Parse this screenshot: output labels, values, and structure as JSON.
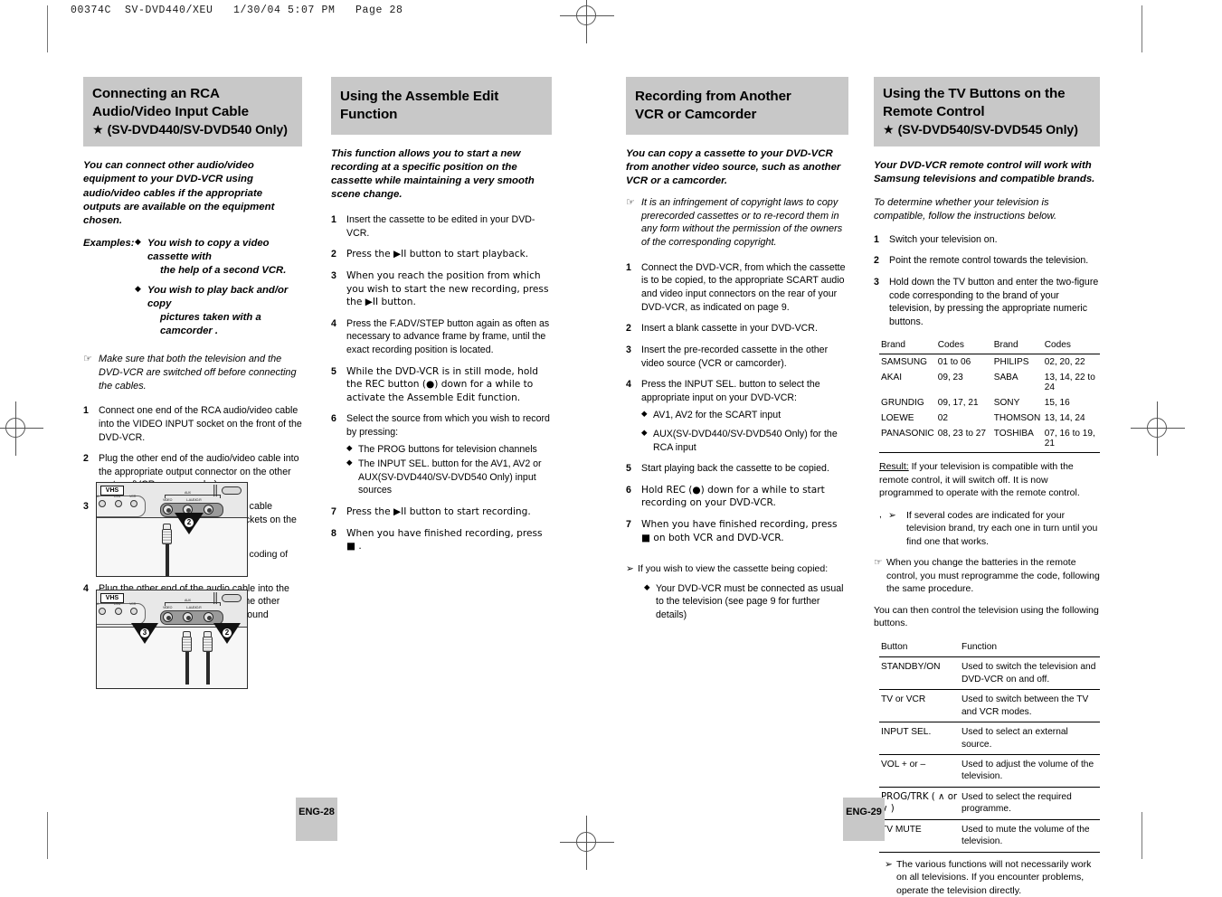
{
  "print_slug": "00374C  SV-DVD440/XEU   1/30/04 5:07 PM   Page 28",
  "colors": {
    "header_bg": "#c8c8c8",
    "page_badge_bg": "#c8c8c8",
    "text": "#000000"
  },
  "sections": {
    "rca": {
      "title_line1": "Connecting an RCA",
      "title_line2": "Audio/Video Input Cable",
      "title_star": "★",
      "title_sub": "(SV-DVD440/SV-DVD540 Only)",
      "lead": "You can connect other audio/video equipment to your DVD-VCR using audio/video cables if the appropriate outputs are available on the equipment chosen.",
      "examples_label": "Examples:",
      "examples": [
        {
          "line1": "You wish to copy a video cassette with",
          "line2": "the help of a second VCR."
        },
        {
          "line1": "You wish to play back and/or copy",
          "line2": "pictures taken with a camcorder ."
        }
      ],
      "hand_note": "Make sure that both the television and the DVD-VCR are switched off before connecting the cables.",
      "steps": [
        {
          "num": "1",
          "text": "Connect one end of the RCA audio/video cable into the VIDEO INPUT socket on the front of the DVD-VCR."
        },
        {
          "num": "2",
          "text": "Plug the other end of the audio/video cable into the appropriate output connector on the other system (VCR or camcorder)."
        },
        {
          "num": "3",
          "text": "Connect one end of the RCA audio cable supplied into the AUDIO INPUT sockets on the front of the DVD-VCR."
        },
        {
          "num": "4",
          "text": "Plug the other end of the audio cable into the appropriate output connectors on the other system (VCR, camcorder or Hi-Fi sound system)."
        }
      ],
      "step3_note": "Take care to respect the colour coding of the left and right channels.",
      "figures": {
        "fig1": {
          "vhs_label": "VHS",
          "callout": "2",
          "jack_labels": [
            "VIDEO",
            "L-AUDIO-R"
          ],
          "aux_label": "AUX"
        },
        "fig2": {
          "vhs_label": "VHS",
          "callouts": [
            "3",
            "2"
          ],
          "jack_labels": [
            "VIDEO",
            "L-AUDIO-R"
          ],
          "aux_label": "AUX"
        }
      }
    },
    "assemble": {
      "title_line1": "Using the Assemble Edit",
      "title_line2": "Function",
      "lead": "This function allows you to start a new recording at a specific position on the cassette while maintaining a very smooth scene change.",
      "steps": [
        {
          "num": "1",
          "text": "Insert the cassette to be edited in your DVD-VCR."
        },
        {
          "num": "2",
          "text": "Press the ▶II button to start playback."
        },
        {
          "num": "3",
          "text": "When you reach the position from which you wish to start the new recording, press the ▶II button."
        },
        {
          "num": "4",
          "text": "Press the F.ADV/STEP button again as often as necessary to advance frame by frame, until the exact recording position is located."
        },
        {
          "num": "5",
          "text": "While the DVD-VCR is in still mode, hold the REC button (●) down for a while to activate the Assemble Edit function."
        },
        {
          "num": "6",
          "text": "Select the source from which you wish to record by pressing:"
        },
        {
          "num": "7",
          "text": "Press the ▶II button to start recording."
        },
        {
          "num": "8",
          "text": "When you have finished recording, press ■ ."
        }
      ],
      "step6_bullets": [
        "The PROG buttons for television channels",
        "The INPUT SEL. button for the AV1, AV2 or AUX(SV-DVD440/SV-DVD540 Only) input sources"
      ]
    },
    "recording": {
      "title_line1": "Recording from Another",
      "title_line2": "VCR or Camcorder",
      "lead": "You can copy a cassette to your DVD-VCR from another video source, such as another VCR or a camcorder.",
      "hand_note": "It is an infringement of copyright laws to copy prerecorded cassettes or to re-record them in any form without the permission of the owners of the corresponding copyright.",
      "steps": [
        {
          "num": "1",
          "text": "Connect the DVD-VCR, from which the cassette is to be copied, to the appropriate SCART audio and video input connectors on the rear of your DVD-VCR, as indicated on page 9."
        },
        {
          "num": "2",
          "text": "Insert a blank cassette in your DVD-VCR."
        },
        {
          "num": "3",
          "text": "Insert the pre-recorded cassette in the other video source (VCR or camcorder)."
        },
        {
          "num": "4",
          "text": "Press the INPUT SEL. button to select the appropriate input on your DVD-VCR:"
        },
        {
          "num": "5",
          "text": "Start playing back the cassette to be copied."
        },
        {
          "num": "6",
          "text": "Hold REC (●) down for a while to start recording on your DVD-VCR."
        },
        {
          "num": "7",
          "text": "When you have finished recording, press ■  on both VCR and DVD-VCR."
        }
      ],
      "step4_bullets": [
        "AV1, AV2 for the SCART input",
        "AUX(SV-DVD440/SV-DVD540 Only) for the RCA input"
      ],
      "tail_note": "If you wish to view the cassette being copied:",
      "tail_bullet": "Your DVD-VCR must be connected as usual to the television (see page 9 for further details)"
    },
    "tvbuttons": {
      "title_line1": "Using the TV Buttons on the",
      "title_line2": "Remote Control",
      "title_star": "★",
      "title_sub": "(SV-DVD540/SV-DVD545 Only)",
      "lead": "Your DVD-VCR remote control will work with Samsung televisions and compatible brands.",
      "lead2": "To determine whether your television is compatible, follow the instructions below.",
      "steps": [
        {
          "num": "1",
          "text": "Switch your television on."
        },
        {
          "num": "2",
          "text": "Point the remote control towards the television."
        },
        {
          "num": "3",
          "text": "Hold down the TV button and enter the two-figure code corresponding to the brand of your television, by pressing the appropriate numeric buttons."
        }
      ],
      "codes_table": {
        "headers": [
          "Brand",
          "Codes",
          "Brand",
          "Codes"
        ],
        "rows": [
          [
            "SAMSUNG",
            "01 to 06",
            "PHILIPS",
            "02, 20, 22"
          ],
          [
            "AKAI",
            "09, 23",
            "SABA",
            "13, 14, 22 to 24"
          ],
          [
            "GRUNDIG",
            "09, 17, 21",
            "SONY",
            "15, 16"
          ],
          [
            "LOEWE",
            "02",
            "THOMSON",
            "13, 14, 24"
          ],
          [
            "PANASONIC",
            "08, 23 to 27",
            "TOSHIBA",
            "07, 16 to 19, 21"
          ]
        ]
      },
      "result_label": "Result:",
      "result_text": "If your television is compatible with the remote control, it will switch off. It is now programmed to operate with the remote control.",
      "arrow_note": "If several codes are indicated for your television brand, try each one in turn until you find one that works.",
      "hand_note": "When you change the batteries in the remote control, you must reprogramme the code, following the same procedure.",
      "post_para": "You can then control the television using the following buttons.",
      "function_table": {
        "headers": [
          "Button",
          "Function"
        ],
        "rows": [
          {
            "button": "STANDBY/ON",
            "function": "Used to switch the television and DVD-VCR on and off."
          },
          {
            "button": "TV or VCR",
            "function": "Used to switch between the TV and VCR modes."
          },
          {
            "button": "INPUT SEL.",
            "function": "Used to select an external source."
          },
          {
            "button": "VOL + or –",
            "function": "Used to adjust the volume of the television."
          },
          {
            "button": "PROG/TRK ( ∧ or  ∨ )",
            "function": "Used to select the required programme."
          },
          {
            "button": "TV MUTE",
            "function": "Used to mute the volume of the television."
          }
        ]
      },
      "final_note": "The various functions will not necessarily work on all televisions. If you encounter problems, operate the television directly."
    }
  },
  "page_badges": {
    "left": "ENG-28",
    "right": "ENG-29"
  },
  "icons": {
    "diamond": "◆",
    "hand": "☞",
    "arrowhead": "➢",
    "play_pause": "▶II",
    "record": "●",
    "stop": "■"
  }
}
